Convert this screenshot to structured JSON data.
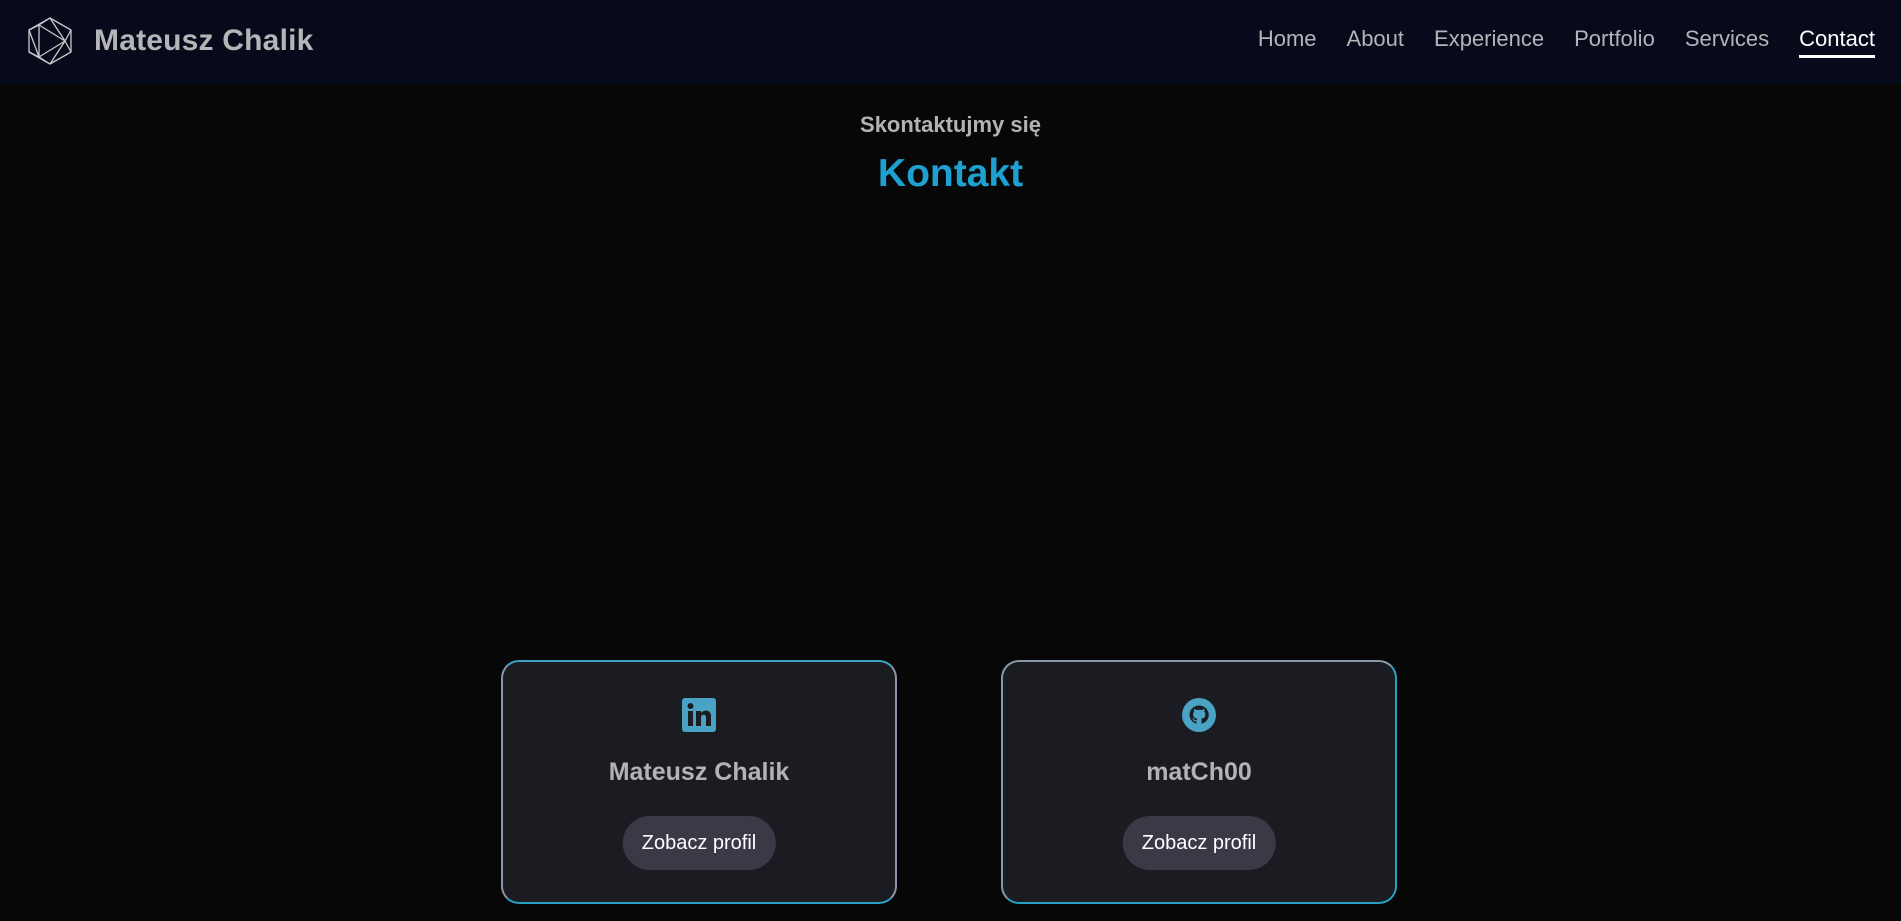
{
  "brand": {
    "name": "Mateusz Chalik",
    "logo_icon": "polyhedron-logo-icon"
  },
  "nav": {
    "items": [
      {
        "label": "Home"
      },
      {
        "label": "About"
      },
      {
        "label": "Experience"
      },
      {
        "label": "Portfolio"
      },
      {
        "label": "Services"
      },
      {
        "label": "Contact"
      }
    ],
    "active": "Contact"
  },
  "section": {
    "subtitle": "Skontaktujmy się",
    "title": "Kontakt"
  },
  "cards": [
    {
      "icon": "linkedin-icon",
      "name": "Mateusz Chalik",
      "button_label": "Zobacz profil"
    },
    {
      "icon": "github-icon",
      "name": "matCh00",
      "button_label": "Zobacz profil"
    }
  ],
  "colors": {
    "background": "#070707",
    "navbar": "#060a1a",
    "accent": "#1ea0d0",
    "card_bg": "#1b1b22",
    "button_bg": "#3a3a47",
    "icon": "#4aa3c4"
  }
}
